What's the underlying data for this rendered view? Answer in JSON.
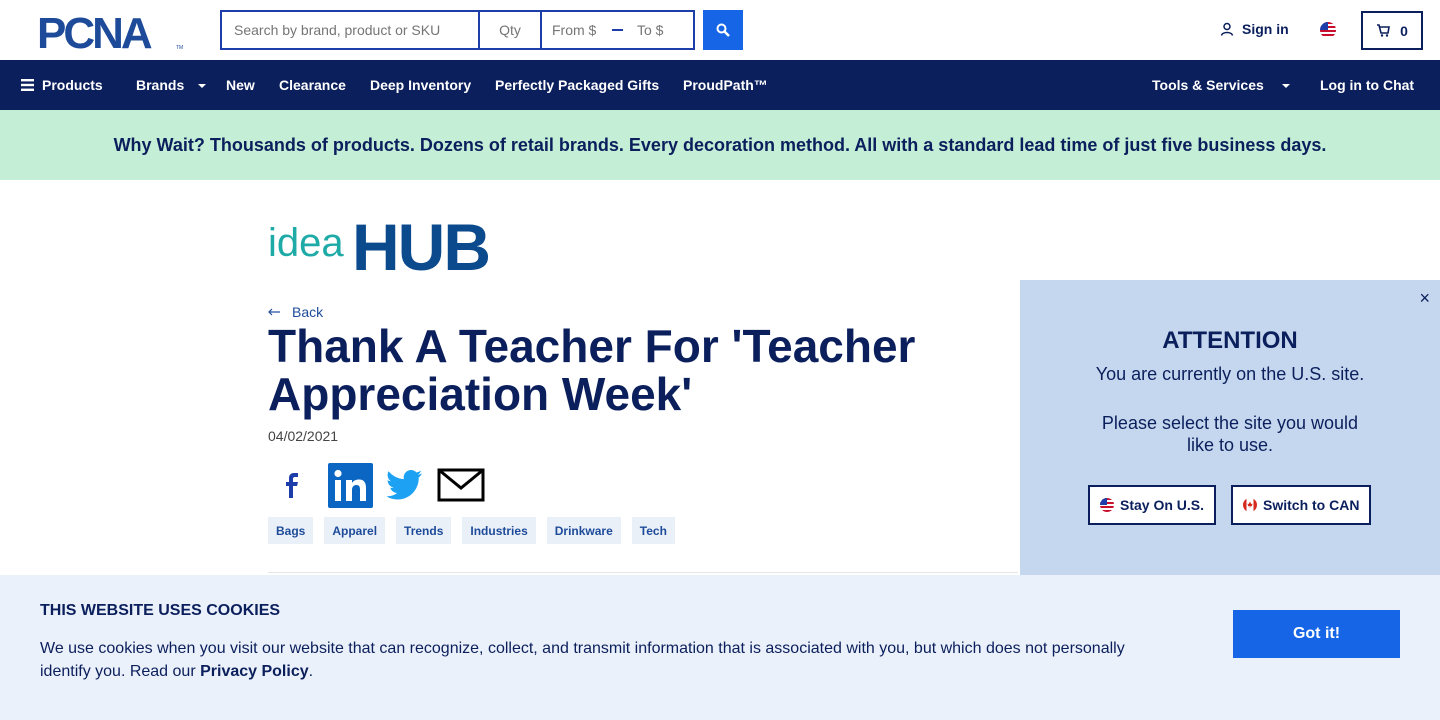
{
  "header": {
    "logo_text": "PCNA",
    "search": {
      "placeholder": "Search by brand, product or SKU",
      "qty_placeholder": "Qty",
      "from_placeholder": "From $",
      "to_placeholder": "To $"
    },
    "sign_in": "Sign in",
    "cart_count": "0"
  },
  "nav": {
    "products": "Products",
    "brands": "Brands",
    "new": "New",
    "clearance": "Clearance",
    "deep_inventory": "Deep Inventory",
    "gifts": "Perfectly Packaged Gifts",
    "proudpath": "ProudPath™",
    "tools": "Tools & Services",
    "chat": "Log in to Chat"
  },
  "promo": "Why Wait? Thousands of products. Dozens of retail brands. Every decoration method. All with a standard lead time of just five business days.",
  "article": {
    "logo_idea": "idea",
    "logo_hub": "HUB",
    "back": "Back",
    "title": "Thank A Teacher For 'Teacher Appreciation Week'",
    "date": "04/02/2021",
    "tags": [
      "Bags",
      "Apparel",
      "Trends",
      "Industries",
      "Drinkware",
      "Tech"
    ]
  },
  "attention": {
    "close": "×",
    "heading": "ATTENTION",
    "line1": "You are currently on the U.S. site.",
    "line2": "Please select the site you would like to use.",
    "stay": "Stay On U.S.",
    "switch": "Switch to CAN"
  },
  "cookie": {
    "heading": "THIS WEBSITE USES COOKIES",
    "body": "We use cookies when you visit our website that can recognize, collect, and transmit information that is associated with you, but which does not personally identify you. Read our ",
    "link": "Privacy Policy",
    "end": ".",
    "button": "Got it!"
  },
  "colors": {
    "navy": "#0b1f5c",
    "blue": "#1565e6",
    "promo_bg": "#c4eed6",
    "popup_bg": "#c5d7ee",
    "cookie_bg": "#ebf1fa"
  }
}
